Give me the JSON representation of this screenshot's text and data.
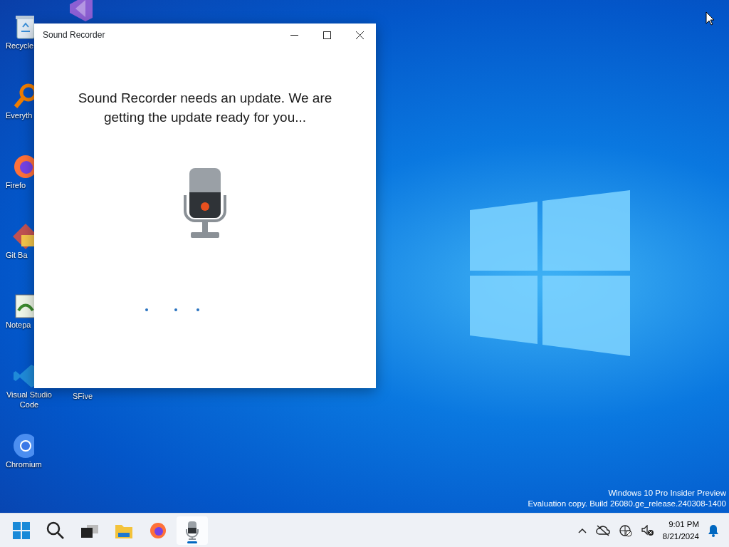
{
  "desktop": {
    "icons": [
      {
        "kind": "recycle",
        "label": "Recycle"
      },
      {
        "kind": "studio"
      },
      {
        "kind": "finder",
        "label": "Everyth"
      },
      {
        "kind": "firefox",
        "label": "Firefo"
      },
      {
        "kind": "git",
        "label": "Git Ba"
      },
      {
        "kind": "notepad",
        "label": "Notepa"
      },
      {
        "kind": "vscode",
        "label": "Visual Studio Code"
      },
      {
        "kind": "none",
        "label": "SFive"
      },
      {
        "kind": "chromium",
        "label": "Chromium"
      }
    ],
    "notice": [
      "Windows 10 Pro Insider Preview",
      "Evaluation copy. Build 26080.ge_release.240308-1400"
    ]
  },
  "window": {
    "title": "Sound Recorder",
    "message": "Sound Recorder needs an update. We are getting the update ready for you..."
  },
  "taskbar": {
    "apps": [
      {
        "kind": "start",
        "selected": false
      },
      {
        "kind": "search",
        "selected": false
      },
      {
        "kind": "taskview",
        "selected": false
      },
      {
        "kind": "folder",
        "selected": false
      },
      {
        "kind": "firefox",
        "selected": false
      },
      {
        "kind": "recorder",
        "selected": true
      }
    ],
    "tray": {
      "time": "9:01 PM",
      "date": "8/21/2024"
    }
  }
}
